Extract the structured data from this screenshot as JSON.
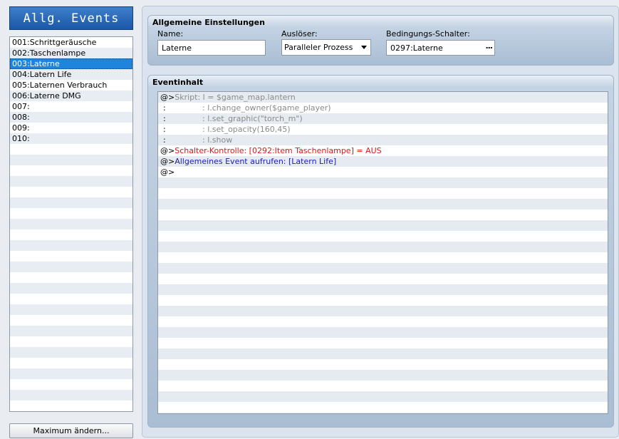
{
  "title": "Allg. Events",
  "events": [
    {
      "label": "001:Schrittgeräusche"
    },
    {
      "label": "002:Taschenlampe"
    },
    {
      "label": "003:Laterne",
      "selected": true
    },
    {
      "label": "004:Latern Life"
    },
    {
      "label": "005:Laternen Verbrauch"
    },
    {
      "label": "006:Laterne DMG"
    },
    {
      "label": "007:"
    },
    {
      "label": "008:"
    },
    {
      "label": "009:"
    },
    {
      "label": "010:"
    }
  ],
  "max_button": "Maximum ändern...",
  "general": {
    "title": "Allgemeine Einstellungen",
    "name_label": "Name:",
    "name_value": "Laterne",
    "trigger_label": "Auslöser:",
    "trigger_value": "Paralleler Prozess",
    "switch_label": "Bedingungs-Schalter:",
    "switch_value": "0297:Laterne",
    "switch_button": "..."
  },
  "content": {
    "title": "Eventinhalt",
    "commands": [
      {
        "prefix": "@>",
        "text": "Skript: l = $game_map.lantern",
        "color": "gray"
      },
      {
        "prefix": " :",
        "text": ": l.change_owner($game_player)",
        "color": "gray"
      },
      {
        "prefix": " :",
        "text": ": l.set_graphic(\"torch_m\")",
        "color": "gray"
      },
      {
        "prefix": " :",
        "text": ": l.set_opacity(160,45)",
        "color": "gray"
      },
      {
        "prefix": " :",
        "text": ": l.show",
        "color": "gray"
      },
      {
        "prefix": "@>",
        "text": "Schalter-Kontrolle: [0292:Item Taschenlampe] = AUS",
        "color": "red"
      },
      {
        "prefix": "@>",
        "text": "Allgemeines Event aufrufen: [Latern Life]",
        "color": "blue"
      },
      {
        "prefix": "@>",
        "text": "",
        "color": "black"
      }
    ]
  }
}
